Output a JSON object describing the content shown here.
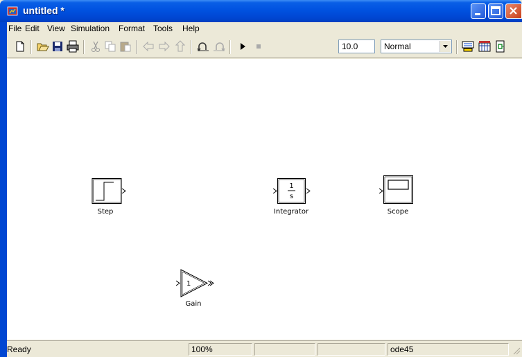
{
  "window": {
    "title": "untitled *"
  },
  "menu": [
    "File",
    "Edit",
    "View",
    "Simulation",
    "Format",
    "Tools",
    "Help"
  ],
  "toolbar": {
    "stop_time": "10.0",
    "sim_mode": "Normal"
  },
  "blocks": {
    "step": {
      "label": "Step"
    },
    "integrator": {
      "label": "Integrator",
      "numerator": "1",
      "denominator": "s"
    },
    "scope": {
      "label": "Scope"
    },
    "gain": {
      "label": "Gain",
      "value": "1"
    }
  },
  "status": {
    "state": "Ready",
    "zoom": "100%",
    "solver": "ode45"
  },
  "colors": {
    "titlebar": "#0052e0",
    "chrome": "#ece9d8",
    "canvas": "#ffffff"
  }
}
